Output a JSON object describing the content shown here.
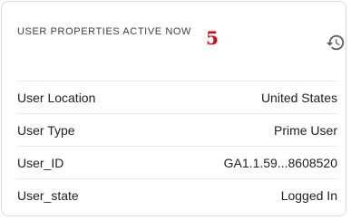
{
  "card": {
    "title": "USER PROPERTIES ACTIVE NOW",
    "count": "5",
    "history_icon": "history-icon"
  },
  "properties": [
    {
      "label": "User Location",
      "value": "United States"
    },
    {
      "label": "User Type",
      "value": "Prime User"
    },
    {
      "label": "User_ID",
      "value": "GA1.1.59...8608520"
    },
    {
      "label": "User_state",
      "value": "Logged In"
    }
  ],
  "colors": {
    "count": "#e8000b",
    "border": "#dadce0",
    "divider": "#e8eaed",
    "text": "#202124"
  }
}
